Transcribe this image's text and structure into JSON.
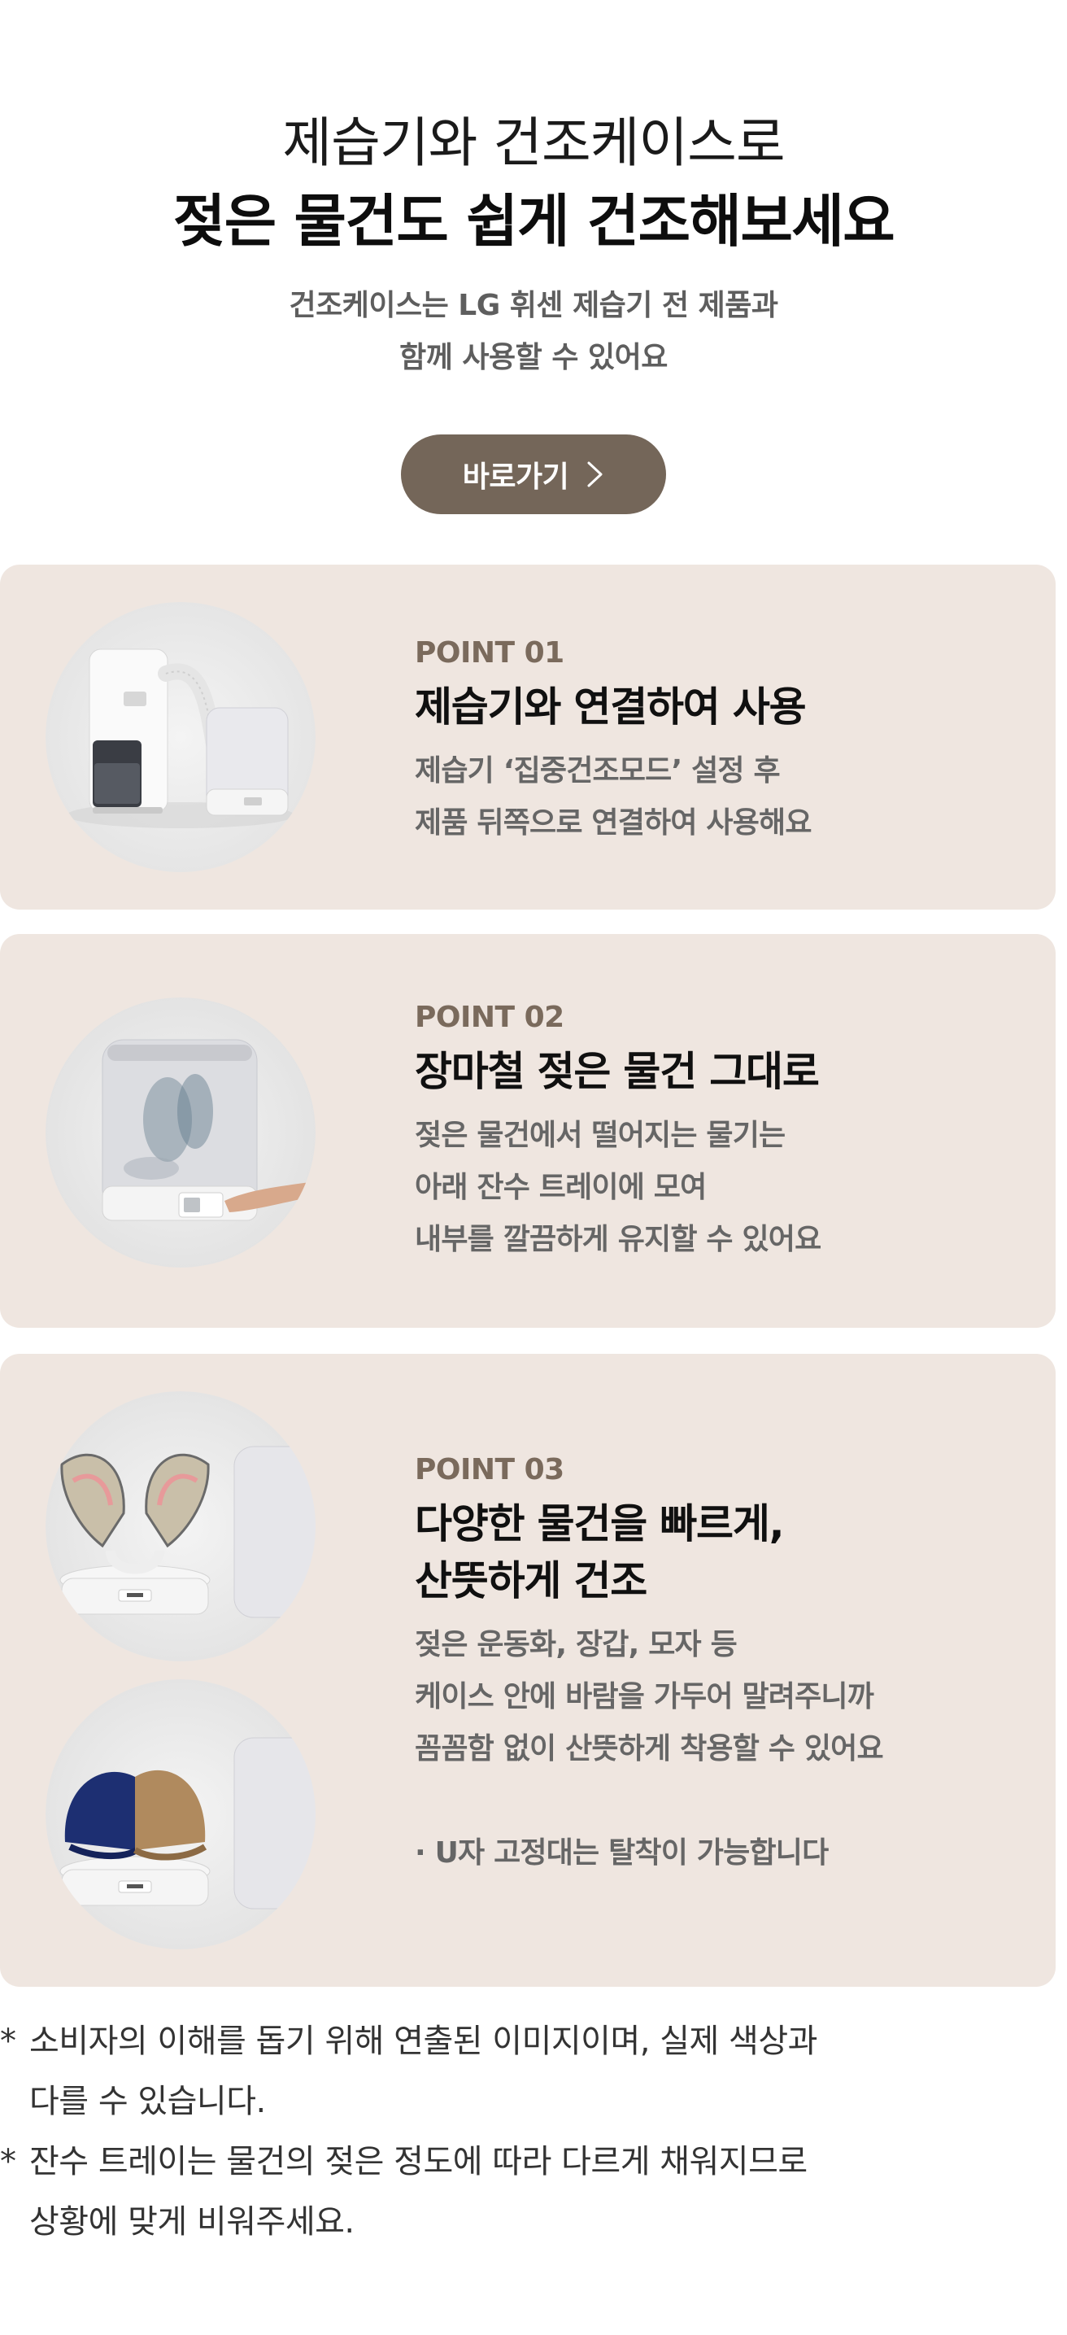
{
  "hero": {
    "line1": "제습기와 건조케이스로",
    "line2": "젖은 물건도 쉽게 건조해보세요",
    "sub_line1": "건조케이스는 LG 휘센 제습기 전 제품과",
    "sub_line2": "함께 사용할 수 있어요",
    "cta_label": "바로가기",
    "cta_icon": "chevron-right-icon"
  },
  "colors": {
    "card_bg": "#efe6e0",
    "cta_bg": "#746659",
    "point_label": "#7a6a5c"
  },
  "points": [
    {
      "label": "POINT 01",
      "title": [
        "제습기와 연결하여 사용"
      ],
      "desc": [
        "제습기 ‘집중건조모드’ 설정 후",
        "제품 뒤쪽으로 연결하여 사용해요"
      ]
    },
    {
      "label": "POINT 02",
      "title": [
        "장마철 젖은 물건 그대로"
      ],
      "desc": [
        "젖은 물건에서 떨어지는 물기는",
        "아래 잔수 트레이에 모여",
        "내부를 깔끔하게 유지할 수 있어요"
      ]
    },
    {
      "label": "POINT 03",
      "title": [
        "다양한 물건을 빠르게,",
        "산뜻하게 건조"
      ],
      "desc": [
        "젖은 운동화, 장갑, 모자 등",
        "케이스 안에 바람을 가두어 말려주니까",
        "꼼꼼함 없이 산뜻하게 착용할 수 있어요"
      ],
      "extra": "· U자 고정대는 탈착이 가능합니다"
    }
  ],
  "notes": [
    {
      "star": "*",
      "line1": "소비자의 이해를 돕기 위해 연출된 이미지이며, 실제 색상과",
      "line2": "다를 수 있습니다."
    },
    {
      "star": "*",
      "line1": "잔수 트레이는 물건의 젖은 정도에 따라 다르게 채워지므로",
      "line2": "상황에 맞게 비워주세요."
    }
  ]
}
